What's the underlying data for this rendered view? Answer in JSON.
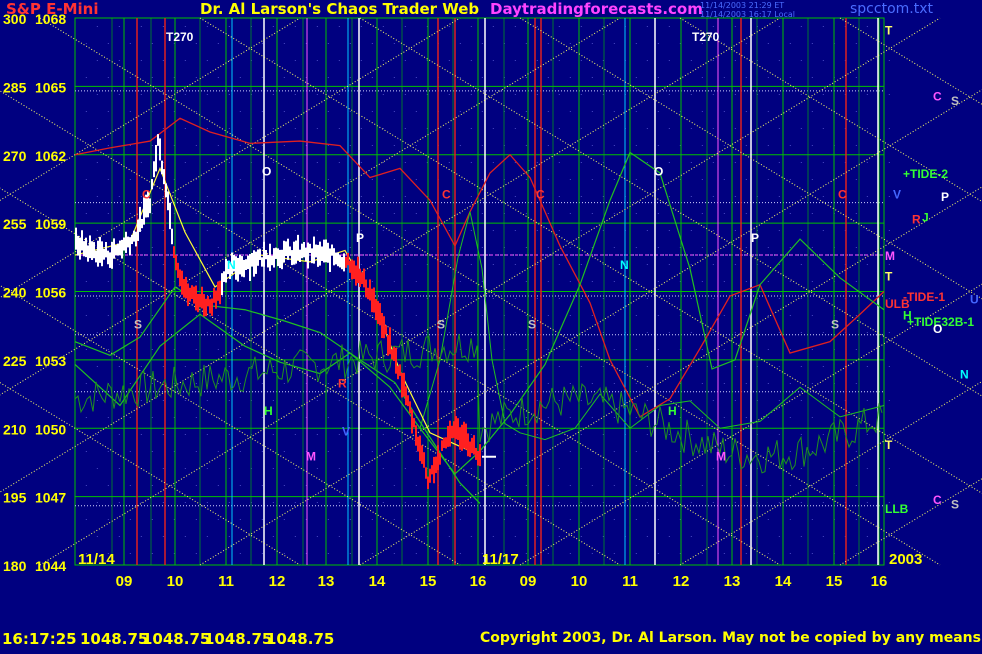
{
  "header": {
    "left_title": "S&P E-Mini",
    "center_title": "Dr. Al Larson's Chaos Trader Web",
    "site": "Daytradingforecasts.com",
    "stamp_line1": "11/14/2003 21:29 ET",
    "stamp_line2": "11/14/2003 16:17 Local",
    "file": "spcctom.txt"
  },
  "footer": {
    "time": "16:17:25",
    "quotes": [
      "1048.75",
      "1048.75",
      "1048.75",
      "1048.75"
    ],
    "copyright": "Copyright 2003, Dr. Al Larson. May not be copied by any means."
  },
  "chart_data": {
    "type": "line",
    "title": "S&P E-Mini",
    "y_price_ticks": [
      1068,
      1065,
      1062,
      1059,
      1056,
      1053,
      1050,
      1047,
      1044
    ],
    "y_point_ticks": [
      300,
      285,
      270,
      255,
      240,
      225,
      210,
      195,
      180
    ],
    "ylim": [
      1044,
      1068
    ],
    "x_ticks": [
      "09",
      "10",
      "11",
      "12",
      "13",
      "14",
      "15",
      "16",
      "09",
      "10",
      "11",
      "12",
      "13",
      "14",
      "15",
      "16"
    ],
    "session_labels": [
      "11/14",
      "11/17"
    ],
    "year": "2003",
    "right_labels": [
      {
        "text": "T",
        "y": 1067.5,
        "color": "#ffff66"
      },
      {
        "text": "C",
        "y": 1064.6,
        "color": "#ff55ff"
      },
      {
        "text": "S",
        "y": 1064.4,
        "color": "#c0c0c0"
      },
      {
        "text": "+TIDE-2",
        "y": 1061.2,
        "color": "#33ff33"
      },
      {
        "text": "V",
        "y": 1060.3,
        "color": "#4466ff"
      },
      {
        "text": "P",
        "y": 1060.2,
        "color": "#ffffff"
      },
      {
        "text": "J",
        "y": 1059.3,
        "color": "#33ff33"
      },
      {
        "text": "R",
        "y": 1059.2,
        "color": "#ff3333"
      },
      {
        "text": "M",
        "y": 1057.6,
        "color": "#ff55ff"
      },
      {
        "text": "T",
        "y": 1056.7,
        "color": "#ffff66"
      },
      {
        "text": "-TIDE-1",
        "y": 1055.8,
        "color": "#ff3333"
      },
      {
        "text": "U",
        "y": 1055.7,
        "color": "#4466ff"
      },
      {
        "text": "ULB",
        "y": 1055.5,
        "color": "#ff3333"
      },
      {
        "text": "H",
        "y": 1055.0,
        "color": "#33ff33"
      },
      {
        "text": "+TIDE32B-1",
        "y": 1054.7,
        "color": "#33ff33"
      },
      {
        "text": "O",
        "y": 1054.4,
        "color": "#ffffff"
      },
      {
        "text": "N",
        "y": 1052.4,
        "color": "#00ffff"
      },
      {
        "text": "T",
        "y": 1049.3,
        "color": "#ffff66"
      },
      {
        "text": "C",
        "y": 1046.9,
        "color": "#ff55ff"
      },
      {
        "text": "S",
        "y": 1046.7,
        "color": "#c0c0c0"
      },
      {
        "text": "LLB",
        "y": 1046.5,
        "color": "#33ff33"
      }
    ],
    "annotations": [
      {
        "text": "T270",
        "x": 166,
        "y": 1067.2,
        "color": "#ffffff"
      },
      {
        "text": "T270",
        "x": 692,
        "y": 1067.2,
        "color": "#ffffff"
      },
      {
        "text": "O",
        "x": 262,
        "y": 1061.3,
        "color": "#ffffff"
      },
      {
        "text": "O",
        "x": 654,
        "y": 1061.3,
        "color": "#ffffff"
      },
      {
        "text": "C",
        "x": 142,
        "y": 1060.3,
        "color": "#ff3333"
      },
      {
        "text": "C",
        "x": 442,
        "y": 1060.3,
        "color": "#ff3333"
      },
      {
        "text": "C",
        "x": 536,
        "y": 1060.3,
        "color": "#ff3333"
      },
      {
        "text": "C",
        "x": 838,
        "y": 1060.3,
        "color": "#ff3333"
      },
      {
        "text": "P",
        "x": 356,
        "y": 1058.4,
        "color": "#ffffff"
      },
      {
        "text": "P",
        "x": 751,
        "y": 1058.4,
        "color": "#ffffff"
      },
      {
        "text": "N",
        "x": 227,
        "y": 1057.2,
        "color": "#00ffff"
      },
      {
        "text": "N",
        "x": 620,
        "y": 1057.2,
        "color": "#00ffff"
      },
      {
        "text": "S",
        "x": 134,
        "y": 1054.6,
        "color": "#c0c0c0"
      },
      {
        "text": "S",
        "x": 437,
        "y": 1054.6,
        "color": "#c0c0c0"
      },
      {
        "text": "S",
        "x": 528,
        "y": 1054.6,
        "color": "#c0c0c0"
      },
      {
        "text": "S",
        "x": 831,
        "y": 1054.6,
        "color": "#c0c0c0"
      },
      {
        "text": "R",
        "x": 338,
        "y": 1052.0,
        "color": "#ff3333"
      },
      {
        "text": "H",
        "x": 264,
        "y": 1050.8,
        "color": "#33ff33"
      },
      {
        "text": "H",
        "x": 668,
        "y": 1050.8,
        "color": "#33ff33"
      },
      {
        "text": "V",
        "x": 342,
        "y": 1049.9,
        "color": "#4466ff"
      },
      {
        "text": "M",
        "x": 306,
        "y": 1048.8,
        "color": "#ff55ff"
      },
      {
        "text": "M",
        "x": 716,
        "y": 1048.8,
        "color": "#ff55ff"
      }
    ]
  },
  "colors": {
    "background": "#000080",
    "grid_green": "#00c000",
    "grid_yellow": "#ffff66",
    "price_white": "#ffffff",
    "price_red": "#ff2020",
    "model_green": "#20c020",
    "model_red": "#e02020",
    "title_red": "#ff3333",
    "title_yellow": "#ffff00",
    "title_magenta": "#ff44ff",
    "file_blue": "#4a6cff"
  }
}
